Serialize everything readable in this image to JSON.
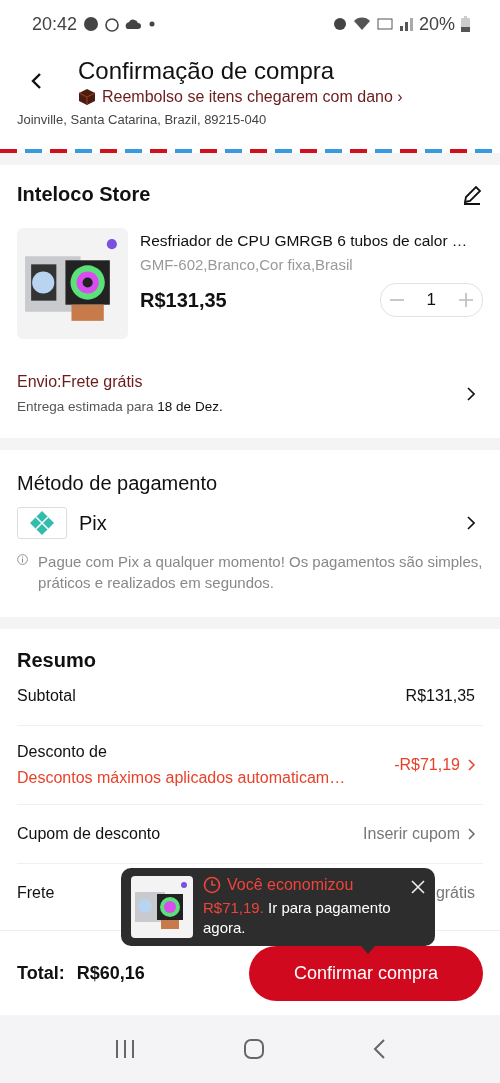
{
  "status_bar": {
    "time": "20:42",
    "battery": "20%"
  },
  "header": {
    "title": "Confirmação de compra",
    "refund_notice": "Reembolso se itens chegarem com dano ›"
  },
  "address": "Joinville, Santa Catarina, Brazil, 89215-040",
  "store": {
    "name": "Inteloco Store",
    "product": {
      "title": "Resfriador de CPU GMRGB 6 tubos de calor …",
      "variant": "GMF-602,Branco,Cor fixa,Brasil",
      "price": "R$131,35",
      "quantity": "1"
    },
    "shipping": {
      "label": "Envio:Frete grátis",
      "estimate_prefix": "Entrega estimada para",
      "estimate_date": "18 de Dez."
    }
  },
  "payment": {
    "title": "Método de pagamento",
    "method": "Pix",
    "note": "Pague com Pix a qualquer momento! Os pagamentos são simples, práticos e realizados em segundos."
  },
  "summary": {
    "title": "Resumo",
    "rows": [
      {
        "kind": "plain",
        "label": "Subtotal",
        "value": "R$131,35"
      },
      {
        "kind": "discount",
        "label": "Desconto de",
        "detail": "Descontos máximos aplicados automaticam…",
        "value": "-R$71,19"
      },
      {
        "kind": "link",
        "label": "Cupom de desconto",
        "value": "Inserir cupom"
      },
      {
        "kind": "muted",
        "label": "Frete",
        "value": "grátis"
      }
    ]
  },
  "toast": {
    "headline": "Você economizou",
    "amount": "R$71,19.",
    "message": "Ir para pagamento agora."
  },
  "footer": {
    "total_label": "Total:",
    "total": "R$60,16",
    "button": "Confirmar compra"
  }
}
